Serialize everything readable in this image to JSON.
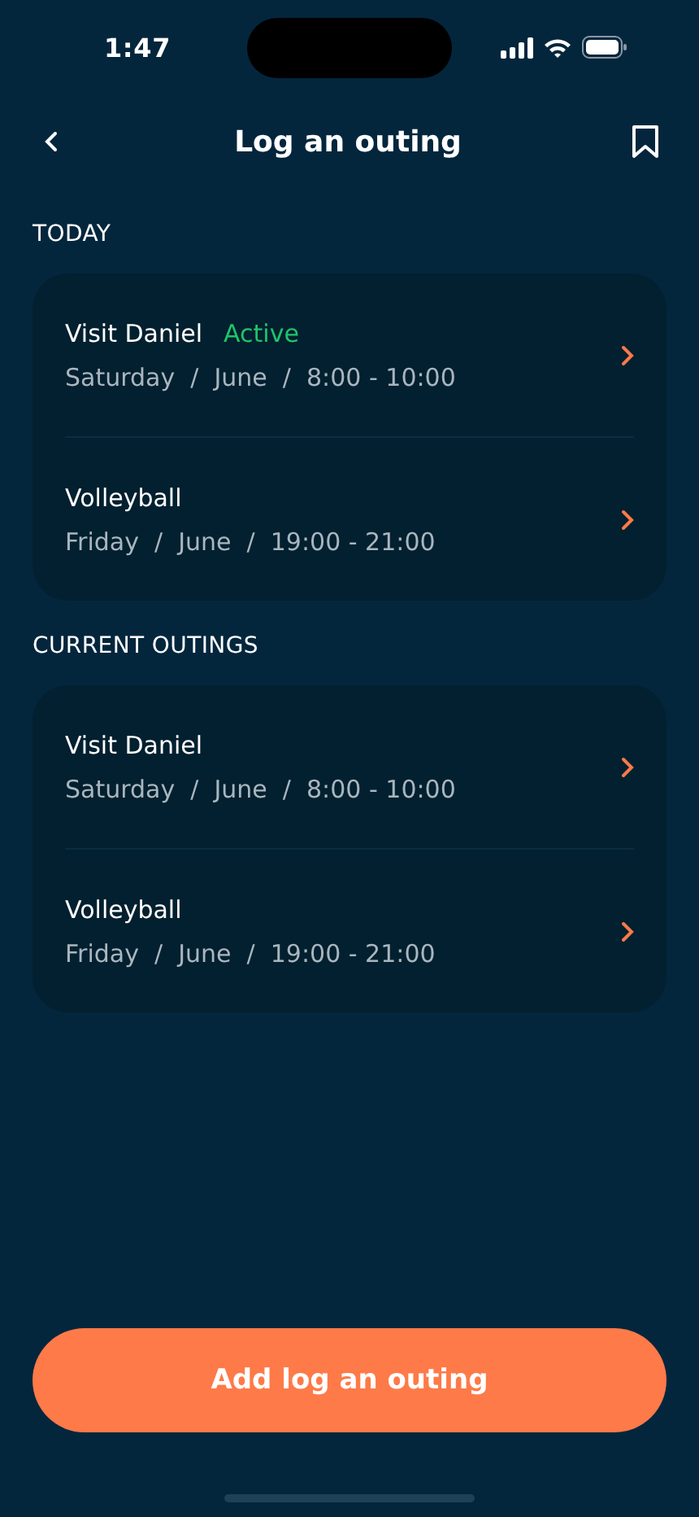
{
  "status_bar": {
    "time": "1:47"
  },
  "header": {
    "title": "Log an outing"
  },
  "sections": [
    {
      "title": "TODAY",
      "outings": [
        {
          "name": "Visit Daniel",
          "status": "Active",
          "details": "Saturday  /  June  /  8:00 - 10:00"
        },
        {
          "name": "Volleyball",
          "details": "Friday  /  June  /  19:00 - 21:00"
        }
      ]
    },
    {
      "title": "CURRENT OUTINGS",
      "outings": [
        {
          "name": "Visit Daniel",
          "details": "Saturday  /  June  /  8:00 - 10:00"
        },
        {
          "name": "Volleyball",
          "details": "Friday  /  June  /  19:00 - 21:00"
        }
      ]
    }
  ],
  "primary_button": {
    "label": "Add log an outing"
  }
}
